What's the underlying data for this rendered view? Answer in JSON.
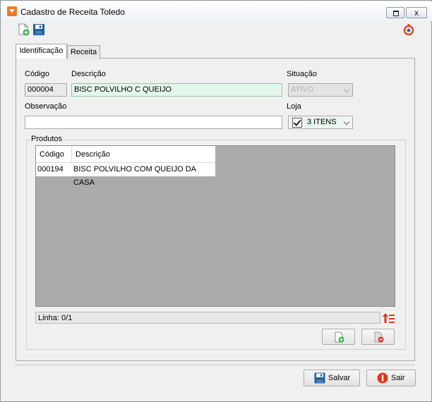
{
  "window": {
    "title": "Cadastro de Receita Toledo",
    "close_glyph": "x"
  },
  "tabs": [
    {
      "label": "Identificação",
      "active": true
    },
    {
      "label": "Receita",
      "active": false
    }
  ],
  "form": {
    "codigo_label": "Código",
    "codigo_value": "000004",
    "descricao_label": "Descrição",
    "descricao_value": "BISC POLVILHO C QUEIJO",
    "situacao_label": "Situação",
    "situacao_value": "ATIVO",
    "observacao_label": "Observação",
    "observacao_value": "",
    "loja_label": "Loja",
    "loja_value": "3 ITENS",
    "loja_checked": true
  },
  "produtos": {
    "group_label": "Produtos",
    "columns": [
      "Código",
      "Descrição"
    ],
    "rows": [
      {
        "codigo": "000194",
        "descricao": "BISC POLVILHO COM QUEIJO DA CASA"
      }
    ],
    "status": "Linha: 0/1"
  },
  "buttons": {
    "salvar": "Salvar",
    "sair": "Sair"
  },
  "colors": {
    "accent_orange": "#f07a22",
    "save_blue": "#1f5f99",
    "exit_red": "#e0361c",
    "add_green": "#2fb24a"
  }
}
